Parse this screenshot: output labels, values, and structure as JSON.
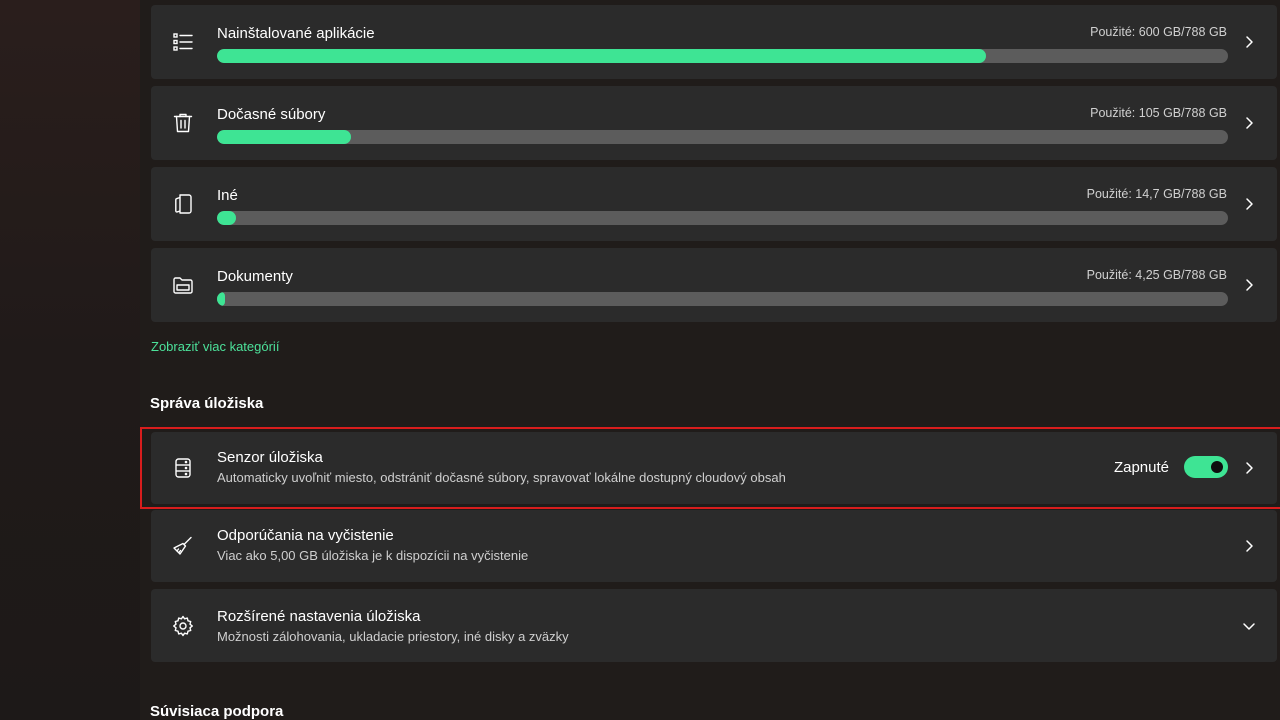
{
  "storage_categories": [
    {
      "label": "Nainštalované aplikácie",
      "used": "Použité: 600 GB/788 GB",
      "fill_fraction": 0.761,
      "icon": "list-icon"
    },
    {
      "label": "Dočasné súbory",
      "used": "Použité: 105 GB/788 GB",
      "fill_fraction": 0.133,
      "icon": "trash-icon"
    },
    {
      "label": "Iné",
      "used": "Použité: 14,7 GB/788 GB",
      "fill_fraction": 0.019,
      "icon": "document-icon"
    },
    {
      "label": "Dokumenty",
      "used": "Použité: 4,25 GB/788 GB",
      "fill_fraction": 0.005,
      "icon": "folder-icon"
    }
  ],
  "show_more_link": "Zobraziť viac kategórií",
  "storage_management": {
    "heading": "Správa úložiska",
    "items": [
      {
        "title": "Senzor úložiska",
        "description": "Automaticky uvoľniť miesto, odstrániť dočasné súbory, spravovať lokálne dostupný cloudový obsah",
        "toggle_label": "Zapnuté",
        "toggle_on": true,
        "icon": "drive-icon"
      },
      {
        "title": "Odporúčania na vyčistenie",
        "description": "Viac ako 5,00 GB úložiska je k dispozícii na vyčistenie",
        "icon": "broom-icon"
      },
      {
        "title": "Rozšírené nastavenia úložiska",
        "description": "Možnosti zálohovania, ukladacie priestory, iné disky a zväzky",
        "icon": "gear-icon"
      }
    ]
  },
  "related_support_heading": "Súvisiaca podpora",
  "colors": {
    "accent": "#3ee494",
    "card_background": "#2b2b2b",
    "page_background": "#201c1a",
    "bar_track": "#5c5c5c",
    "highlight_border": "#d81d1d"
  }
}
